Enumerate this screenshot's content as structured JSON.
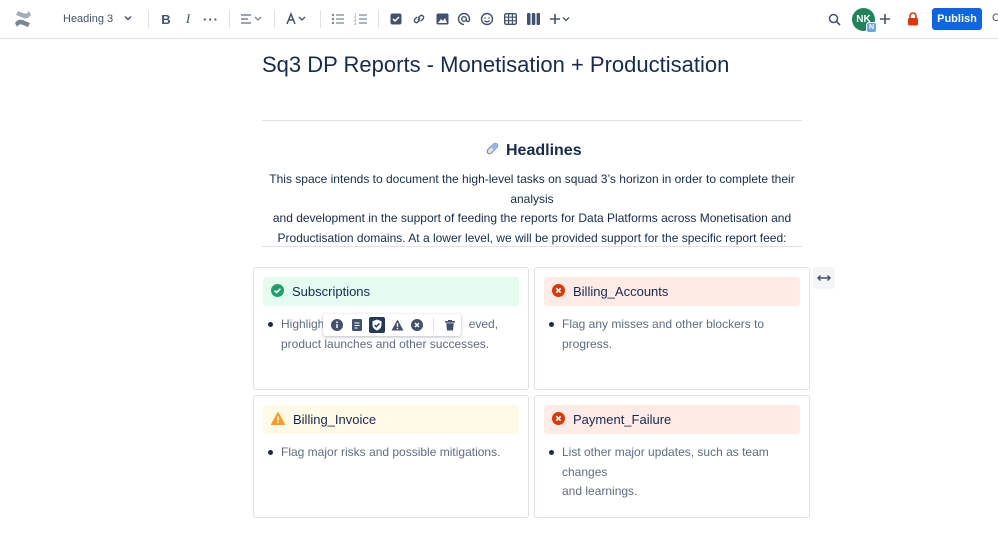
{
  "toolbar": {
    "text_style": "Heading 3",
    "publish_label": "Publish",
    "avatar_initials": "NK",
    "avatar_badge": "N",
    "cut_off_label": "C",
    "accent_color": "#0c66e4"
  },
  "page": {
    "title": "Sq3 DP Reports - Monetisation + Productisation",
    "headline": {
      "icon": "pill-emoji",
      "text": "Headlines"
    },
    "intro_lines": [
      "This space intends to document the high-level tasks on squad 3’s horizon in order to complete their analysis",
      "and development in the support of feeding the reports for Data Platforms across Monetisation and",
      "Productisation domains. At a lower level, we will be provided support for the specific report feed:"
    ]
  },
  "panels": [
    {
      "type": "success",
      "icon": "check-circle-icon",
      "title": "Subscriptions",
      "bullet_lines": [
        "Highlight",
        "eved,",
        "product launches and other successes."
      ]
    },
    {
      "type": "error",
      "icon": "cross-circle-icon",
      "title": "Billing_Accounts",
      "bullet_lines": [
        "Flag any misses and other blockers to progress."
      ]
    },
    {
      "type": "warning",
      "icon": "warning-icon",
      "title": "Billing_Invoice",
      "bullet_lines": [
        "Flag major risks and possible mitigations."
      ]
    },
    {
      "type": "error",
      "icon": "cross-circle-icon",
      "title": "Payment_Failure",
      "bullet_lines": [
        "List other major updates, such as team changes",
        "and learnings."
      ]
    }
  ],
  "panel_toolbar": {
    "options": [
      "info-icon",
      "note-icon",
      "success-icon",
      "warning-icon",
      "error-icon",
      "delete-icon"
    ],
    "active": "success-icon"
  },
  "colors": {
    "success_bg": "#e3fcef",
    "error_bg": "#ffebe6",
    "warning_bg": "#fffae6",
    "success_icon": "#22a06b",
    "error_icon": "#de350b",
    "warning_icon": "#ff991f"
  }
}
